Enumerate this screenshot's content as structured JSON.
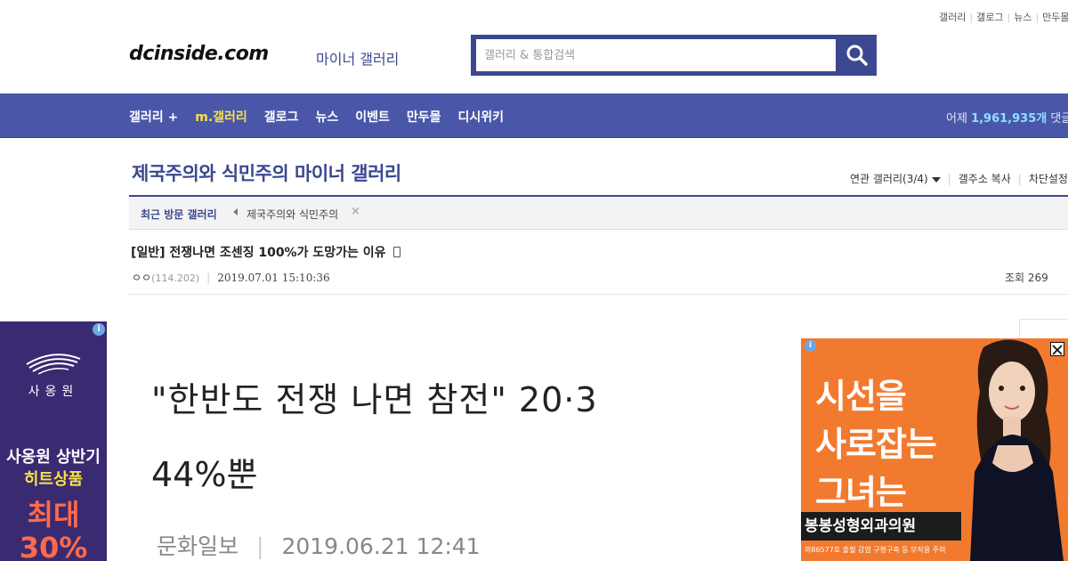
{
  "util_links": [
    "갤러리",
    "갤로그",
    "뉴스",
    "만두몰"
  ],
  "header": {
    "logo": "dcinside.com",
    "logo_sub": "마이너 갤러리",
    "search_placeholder": "갤러리 & 통합검색"
  },
  "nav": {
    "items": [
      "갤러리 +",
      "m.갤러리",
      "갤로그",
      "뉴스",
      "이벤트",
      "만두몰",
      "디시위키"
    ],
    "stats_prefix": "어제",
    "stats_count": "1,961,935개",
    "stats_suffix": "댓글"
  },
  "gallery": {
    "title": "제국주의와 식민주의 마이너 갤러리",
    "related": "연관 갤러리(3/4)",
    "copy_addr": "갤주소 복사",
    "block": "차단설정"
  },
  "recent": {
    "label": "최근 방문 갤러리",
    "item": "제국주의와 식민주의"
  },
  "post": {
    "title": "[일반] 전쟁나면 조센징 100%가 도망가는 이유",
    "author": "ㅇㅇ",
    "ip": "(114.202)",
    "date": "2019.07.01 15:10:36",
    "views": "조회 269"
  },
  "article_image": {
    "headline1": "\"한반도 전쟁 나면 참전\" 20·3",
    "headline2": "44%뿐",
    "source": "문화일보",
    "date": "2019.06.21 12:41"
  },
  "ad_left": {
    "brand": "사옹원",
    "line1": "사옹원 상반기",
    "line2": "히트상품",
    "line3": "최대",
    "line4": "30%"
  },
  "ad_right": {
    "line1": "시선을",
    "line2": "사로잡는",
    "line3": "그녀는",
    "clinic": "봉봉성형외과의원",
    "note": "의86577호 출혈 감염 구형구축 등 부작용 주의"
  },
  "colors": {
    "brand_blue": "#3b4890",
    "nav_bg": "#4a57a8",
    "highlight": "#f8e14b",
    "ad_orange": "#f27a2e",
    "ad_purple": "#3a2a72"
  }
}
